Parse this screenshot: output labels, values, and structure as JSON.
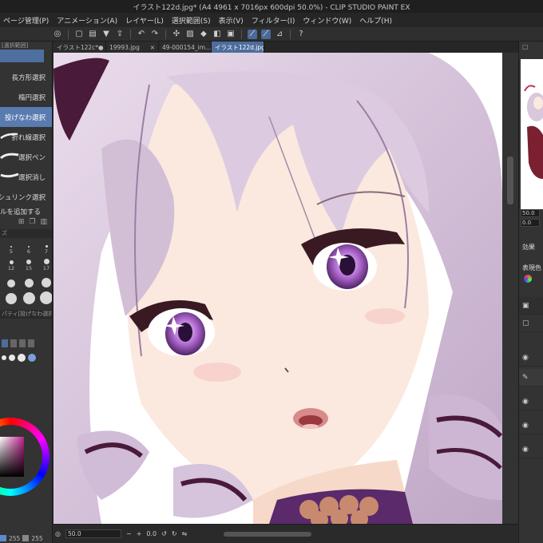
{
  "window": {
    "title": "イラスト122d.jpg* (A4 4961 x 7016px 600dpi 50.0%) - CLIP STUDIO PAINT EX"
  },
  "menu": [
    "ページ管理(P)",
    "アニメーション(A)",
    "レイヤー(L)",
    "選択範囲(S)",
    "表示(V)",
    "フィルター(I)",
    "ウィンドウ(W)",
    "ヘルプ(H)"
  ],
  "toolbar": {
    "icons": [
      "clip-studio-icon",
      "new-icon",
      "open-icon",
      "save-icon",
      "export-icon",
      "undo-icon",
      "redo-icon",
      "clear-icon",
      "fill-icon",
      "deselect-icon",
      "invert-icon",
      "ruler-icon",
      "snap-icon",
      "snap-special-icon",
      "ruler-edit-icon",
      "help-icon"
    ]
  },
  "left_panel": {
    "header": "[選択範囲]",
    "subtools": [
      {
        "label": "長方形選択",
        "selected": false
      },
      {
        "label": "楕円選択",
        "selected": false
      },
      {
        "label": "投げなわ選択",
        "selected": true
      },
      {
        "label": "折れ線選択",
        "selected": false
      },
      {
        "label": "選択ペン",
        "selected": false
      },
      {
        "label": "選択消し",
        "selected": false
      },
      {
        "label": "シュリンク選択",
        "selected": false
      }
    ],
    "add_label": "ルを追加する",
    "brush_size_section": "ズ",
    "brush_sizes": [
      "5",
      "6",
      "7",
      "12",
      "15",
      "17",
      "",
      "",
      "",
      "",
      "",
      ""
    ],
    "tool_property_section": "パティ[投げなわ選択]",
    "color_values": {
      "a": "255",
      "b": "255"
    }
  },
  "tabs": [
    {
      "label": "イラスト122c*",
      "active": false
    },
    {
      "label": "19993.jpg",
      "active": false
    },
    {
      "label": "49-000154_im...",
      "active": false
    },
    {
      "label": "イラスト122d.jpg*",
      "active": true
    }
  ],
  "status": {
    "zoom": "50.0",
    "rotation": "0.0"
  },
  "right_panel": {
    "zoom": "50.0",
    "rotation": "0.0",
    "effect_label": "効果",
    "expression_label": "表現色"
  },
  "colors": {
    "accent": "#4d6d9c",
    "selected_subtool": "#5a7bb0",
    "panel_bg": "#333333",
    "hair": "#d9c7dc",
    "skin": "#fbe9df",
    "iris": "#b46fd0"
  }
}
